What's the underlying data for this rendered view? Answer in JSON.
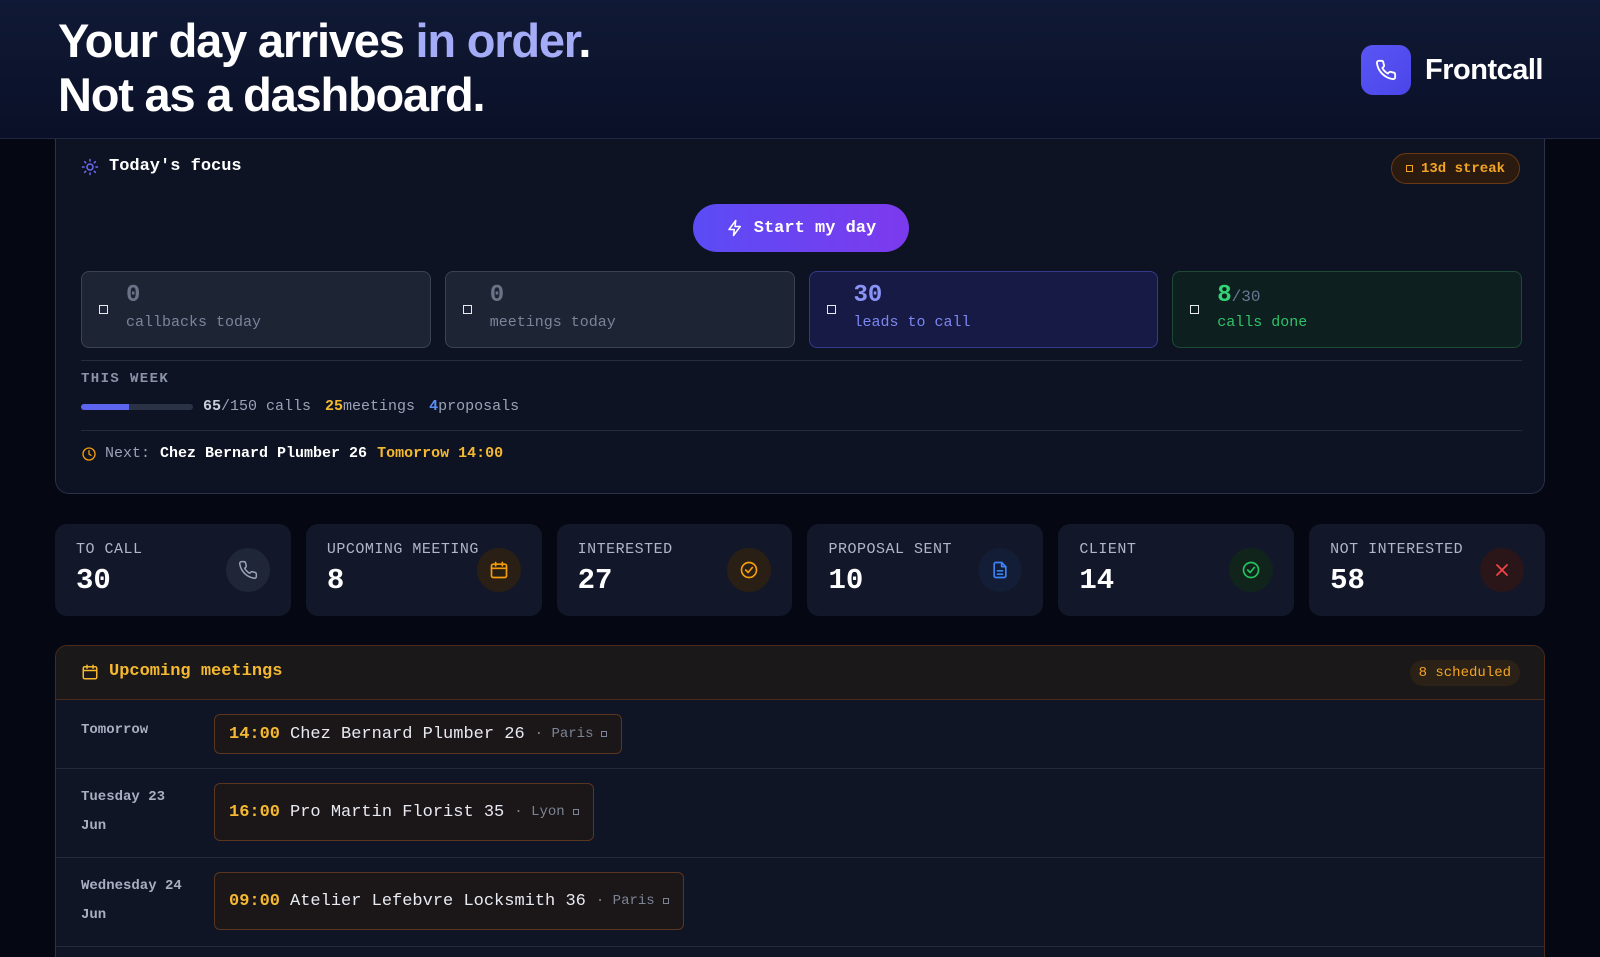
{
  "hero": {
    "line1_before": "Your day arrives ",
    "line1_accent": "in order",
    "line1_after": ".",
    "line2": "Not as a dashboard."
  },
  "brand": {
    "name": "Frontcall",
    "icon": "phone-icon"
  },
  "focus": {
    "title": "Today's focus",
    "streak": "13d streak",
    "start_button": "Start my day",
    "stats": [
      {
        "num": "0",
        "label": "callbacks today"
      },
      {
        "num": "0",
        "label": "meetings today"
      },
      {
        "num": "30",
        "label": "leads to call"
      },
      {
        "num": "8",
        "total": "/30",
        "label": "calls done"
      }
    ],
    "week": {
      "title": "THIS WEEK",
      "progress": 0.43,
      "calls_done": "65",
      "calls_total": "/150 calls",
      "meetings": "25",
      "meetings_label": " meetings",
      "proposals": "4",
      "proposals_label": " proposals"
    },
    "next": {
      "label": "Next:",
      "name": "Chez Bernard Plumber 26",
      "time": "Tomorrow 14:00"
    }
  },
  "pipeline": [
    {
      "label": "TO CALL",
      "value": "30",
      "icon": "phone-icon",
      "color": "#9aa2b6"
    },
    {
      "label": "UPCOMING MEETING",
      "value": "8",
      "icon": "calendar-icon",
      "color": "#f59e0b"
    },
    {
      "label": "INTERESTED",
      "value": "27",
      "icon": "check-circle-icon",
      "color": "#f59e0b"
    },
    {
      "label": "PROPOSAL SENT",
      "value": "10",
      "icon": "document-icon",
      "color": "#3b82f6"
    },
    {
      "label": "CLIENT",
      "value": "14",
      "icon": "check-circle-icon",
      "color": "#22c55e"
    },
    {
      "label": "NOT INTERESTED",
      "value": "58",
      "icon": "x-icon",
      "color": "#ef4444"
    }
  ],
  "meetings": {
    "title": "Upcoming meetings",
    "count": "8 scheduled",
    "rows": [
      {
        "day": "Tomorrow",
        "time": "14:00",
        "name": "Chez Bernard Plumber 26",
        "city": "· Paris"
      },
      {
        "day": "Tuesday 23 Jun",
        "time": "16:00",
        "name": "Pro Martin Florist 35",
        "city": "· Lyon"
      },
      {
        "day": "Wednesday 24 Jun",
        "time": "09:00",
        "name": "Atelier Lefebvre Locksmith 36",
        "city": "· Paris"
      }
    ]
  }
}
